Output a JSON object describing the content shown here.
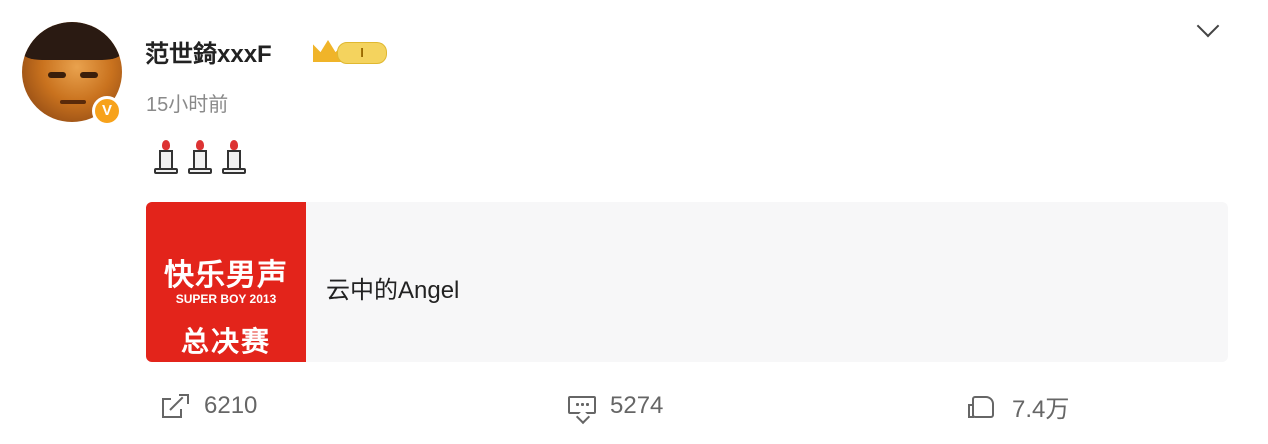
{
  "post": {
    "username": "范世錡xxxF",
    "level_label": "I",
    "timestamp": "15小时前",
    "verified_badge": "V",
    "content_emoji": [
      "candle",
      "candle",
      "candle"
    ],
    "card": {
      "thumb_line1": "快乐男声",
      "thumb_line2": "SUPER BOY 2013",
      "thumb_line3": "总决赛",
      "title": "云中的Angel",
      "thumb_color": "#e3241b"
    },
    "stats": {
      "share_count": "6210",
      "comment_count": "5274",
      "like_count": "7.4万"
    },
    "icons": {
      "share": "share-icon",
      "comment": "comment-icon",
      "like": "like-icon",
      "menu": "chevron-down-icon"
    }
  }
}
